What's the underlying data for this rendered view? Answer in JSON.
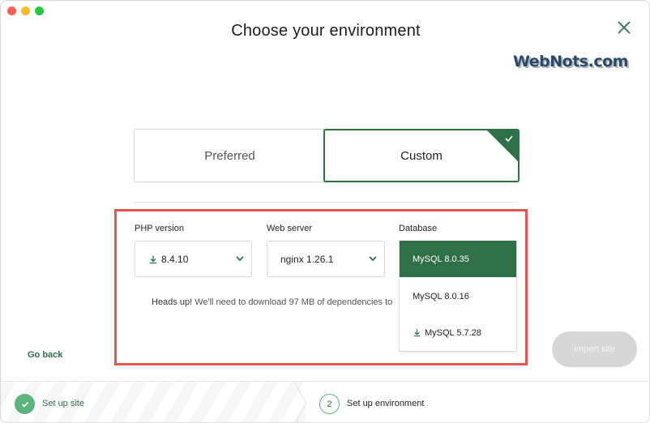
{
  "header": {
    "title": "Choose your environment",
    "watermark": "WebNots.com"
  },
  "toggle": {
    "preferred_label": "Preferred",
    "custom_label": "Custom",
    "selected": "Custom"
  },
  "fields": {
    "php": {
      "label": "PHP version",
      "value": "8.4.10",
      "icon": "download-icon"
    },
    "web_server": {
      "label": "Web server",
      "value": "nginx 1.26.1"
    },
    "database": {
      "label": "Database",
      "options": [
        {
          "label": "MySQL 8.0.35",
          "selected": true,
          "download": false
        },
        {
          "label": "MySQL 8.0.16",
          "selected": false,
          "download": false
        },
        {
          "label": "MySQL 5.7.28",
          "selected": false,
          "download": true
        }
      ]
    }
  },
  "note": {
    "bold": "Heads up!",
    "text": " We'll need to download 97 MB of dependencies to"
  },
  "actions": {
    "go_back": "Go back",
    "import_site": "Import site"
  },
  "steps": [
    {
      "number": "",
      "label": "Set up site",
      "status": "complete"
    },
    {
      "number": "2",
      "label": "Set up environment",
      "status": "current"
    }
  ],
  "colors": {
    "brand_green": "#2e7048",
    "step_green": "#5cb57c",
    "highlight_red": "#e8554c",
    "disabled_button": "#d6d6d6"
  }
}
